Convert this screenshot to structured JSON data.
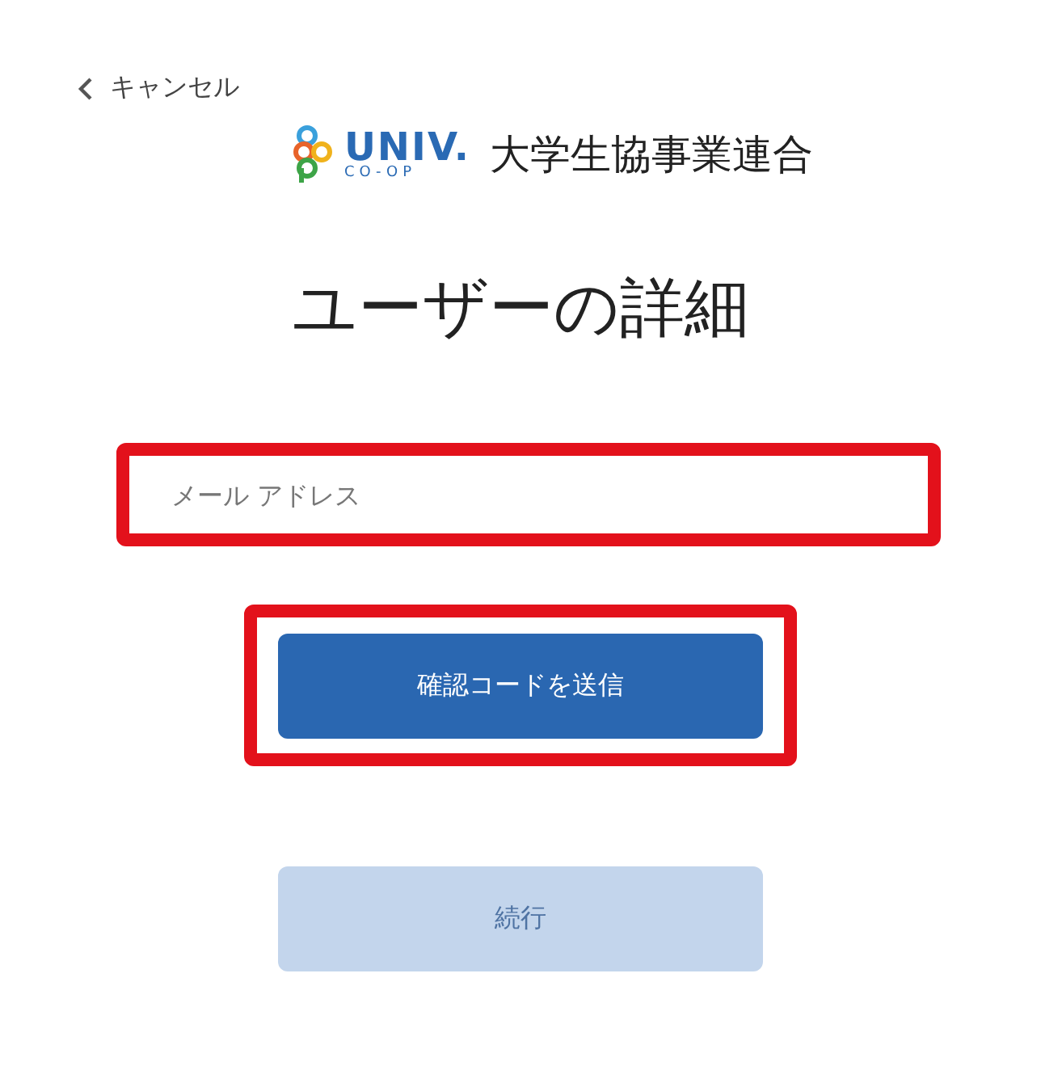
{
  "cancel_link": {
    "label": "キャンセル"
  },
  "logo": {
    "wordmark": "UNIV.",
    "subtitle": "CO-OP",
    "organization": "大学生協事業連合"
  },
  "title": "ユーザーの詳細",
  "email_field": {
    "placeholder": "メール アドレス",
    "highlighted": true
  },
  "send_code_button": {
    "label": "確認コードを送信",
    "highlighted": true,
    "disabled": false
  },
  "continue_button": {
    "label": "続行",
    "disabled": true
  }
}
